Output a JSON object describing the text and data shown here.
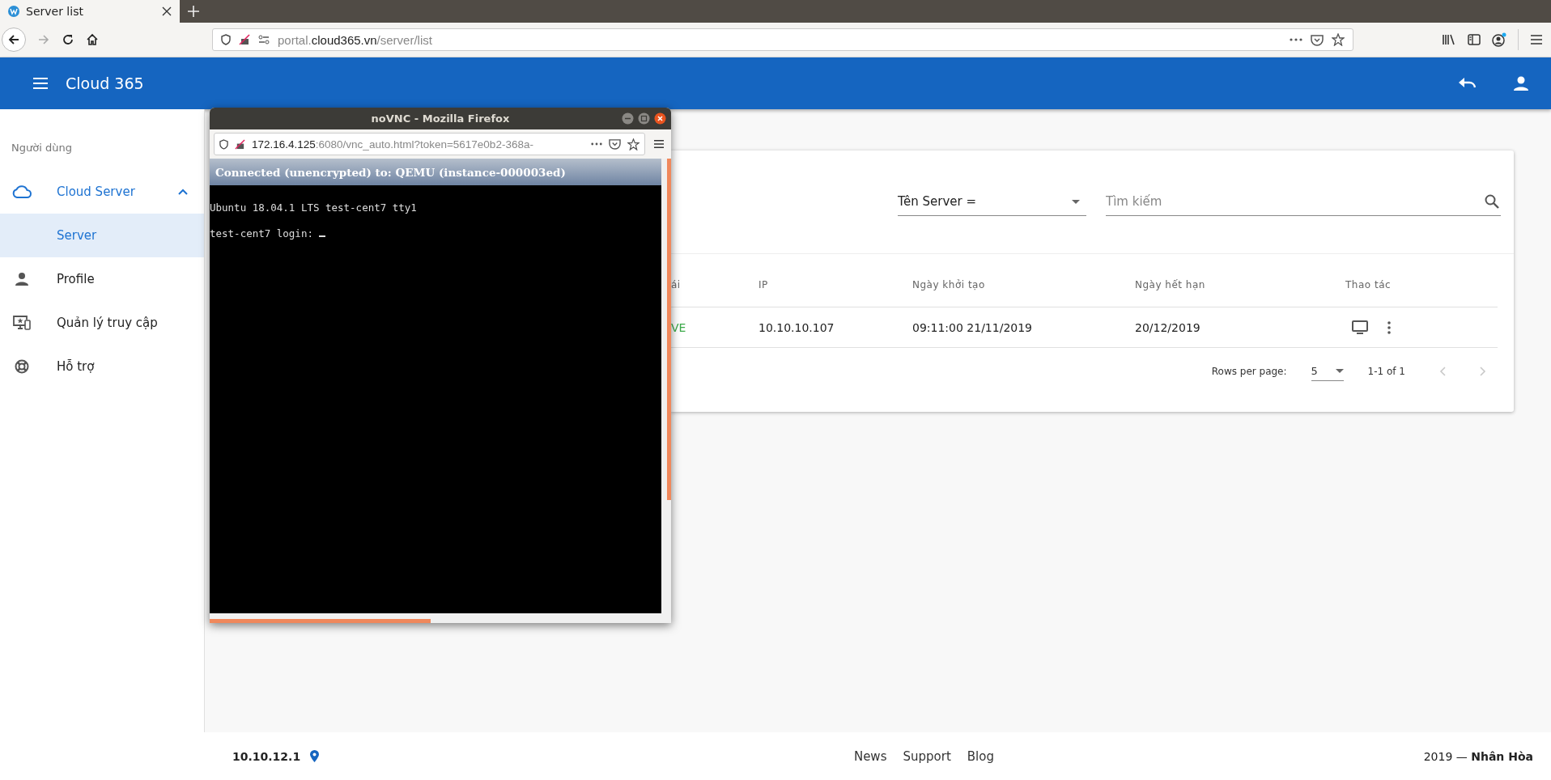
{
  "browser": {
    "tab": {
      "title": "Server list"
    },
    "url": {
      "prefix": "portal.",
      "domain": "cloud365.vn",
      "path": "/server/list"
    }
  },
  "app_bar": {
    "title": "Cloud 365"
  },
  "sidebar": {
    "section": "Người dùng",
    "items": [
      {
        "label": "Cloud Server",
        "selected": false,
        "expanded": true,
        "children": [
          {
            "label": "Server",
            "selected": true
          }
        ]
      },
      {
        "label": "Profile",
        "selected": false
      },
      {
        "label": "Quản lý truy cập",
        "selected": false
      },
      {
        "label": "Hỗ trợ",
        "selected": false
      }
    ]
  },
  "filter": {
    "select": {
      "value": "Tên Server ="
    },
    "search": {
      "placeholder": "Tìm kiếm"
    }
  },
  "table": {
    "columns": [
      "ái",
      "IP",
      "Ngày khởi tạo",
      "Ngày hết hạn",
      "Thao tác"
    ],
    "rows": [
      {
        "cells": [
          "VE",
          "10.10.10.107",
          "09:11:00 21/11/2019",
          "20/12/2019"
        ]
      }
    ]
  },
  "pagination": {
    "label": "Rows per page:",
    "value": "5",
    "range": "1-1 of 1",
    "prev_disabled": true,
    "next_disabled": true
  },
  "footer": {
    "ip": "10.10.12.1",
    "links": [
      "News",
      "Support",
      "Blog"
    ],
    "copyright": "2019 — **Nhân Hòa**"
  },
  "popup": {
    "title": "noVNC - Mozilla Firefox",
    "url": {
      "host": "172.16.4.125",
      "rest": ":6080/vnc_auto.html?token=5617e0b2-368a-"
    },
    "status": "Connected (unencrypted) to: QEMU (instance-000003ed)",
    "lines": [
      "Ubuntu 18.04.1 LTS test-cent7 tty1",
      "test-cent7 login: "
    ],
    "cursor": true
  }
}
